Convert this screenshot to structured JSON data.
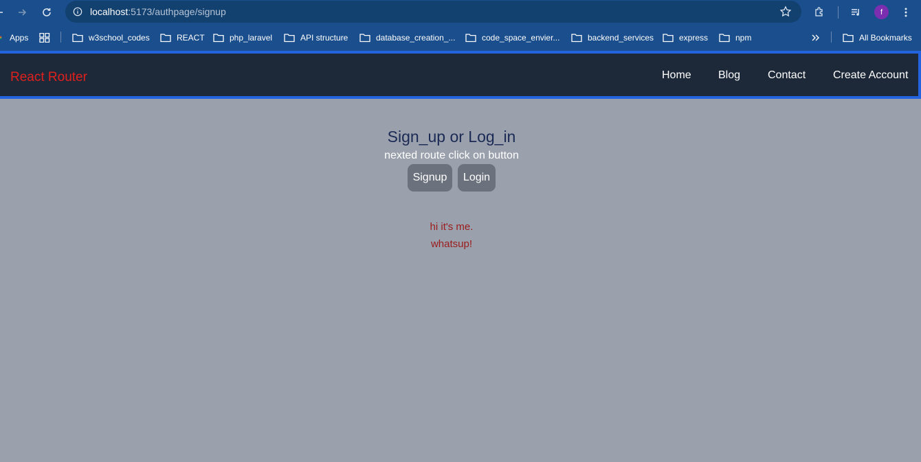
{
  "browser": {
    "url_host": "localhost",
    "url_rest": ":5173/authpage/signup",
    "avatar_letter": "f"
  },
  "bookmarks": {
    "apps": "Apps",
    "items": [
      "w3school_codes",
      "REACT",
      "php_laravel",
      "API structure",
      "database_creation_...",
      "code_space_envier...",
      "backend_services",
      "express",
      "npm"
    ],
    "all": "All Bookmarks"
  },
  "navbar": {
    "brand": "React Router",
    "links": [
      "Home",
      "Blog",
      "Contact",
      "Create Account"
    ]
  },
  "content": {
    "heading": "Sign_up or Log_in",
    "subheading": "nexted route click on button",
    "buttons": [
      "Signup",
      "Login"
    ],
    "messages": [
      "hi it's me.",
      "whatsup!"
    ]
  },
  "colors": {
    "toolbar": "#1a4e8c",
    "navbar": "#1d2939",
    "navbar_border": "#2463e0",
    "brand": "#e0201d",
    "page_bg": "#9aa0ac",
    "button_bg": "#6b717d",
    "message": "#9b1b1b"
  }
}
